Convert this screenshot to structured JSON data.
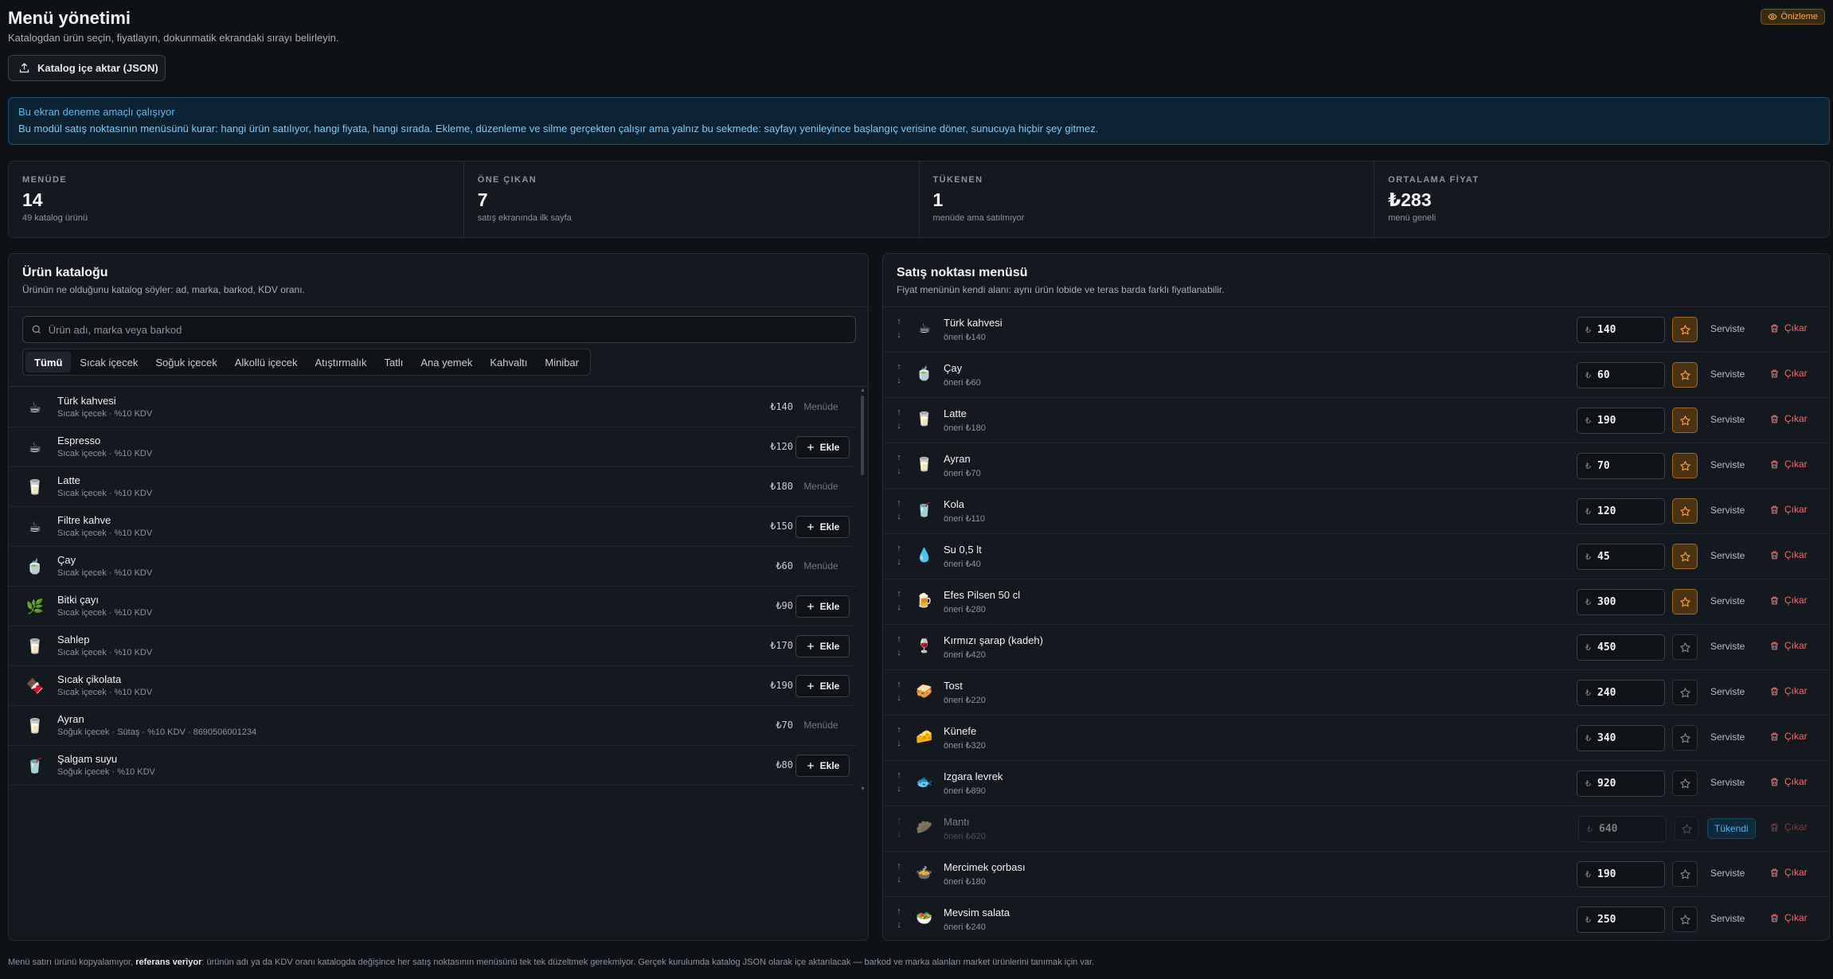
{
  "header": {
    "title": "Menü yönetimi",
    "subtitle": "Katalogdan ürün seçin, fiyatlayın, dokunmatik ekrandaki sırayı belirleyin.",
    "preview_label": "Önizleme"
  },
  "import_button": {
    "label": "Katalog içe aktar (JSON)"
  },
  "notice": {
    "title": "Bu ekran deneme amaçlı çalışıyor",
    "body": "Bu modül satış noktasının menüsünü kurar: hangi ürün satılıyor, hangi fiyata, hangi sırada. Ekleme, düzenleme ve silme gerçekten çalışır ama yalnız bu sekmede: sayfayı yenileyince başlangıç verisine döner, sunucuya hiçbir şey gitmez."
  },
  "stats": [
    {
      "label": "MENÜDE",
      "value": "14",
      "sub": "49 katalog ürünü"
    },
    {
      "label": "ÖNE ÇIKAN",
      "value": "7",
      "sub": "satış ekranında ilk sayfa"
    },
    {
      "label": "TÜKENEN",
      "value": "1",
      "sub": "menüde ama satılmıyor"
    },
    {
      "label": "ORTALAMA FİYAT",
      "value": "₺283",
      "sub": "menü geneli"
    }
  ],
  "catalog": {
    "title": "Ürün kataloğu",
    "subtitle": "Ürünün ne olduğunu katalog söyler: ad, marka, barkod, KDV oranı.",
    "search_placeholder": "Ürün adı, marka veya barkod",
    "tabs": [
      "Tümü",
      "Sıcak içecek",
      "Soğuk içecek",
      "Alkollü içecek",
      "Atıştırmalık",
      "Tatlı",
      "Ana yemek",
      "Kahvaltı",
      "Minibar"
    ],
    "in_menu_label": "Menüde",
    "add_label": "Ekle",
    "items": [
      {
        "emoji": "☕",
        "name": "Türk kahvesi",
        "meta": "Sıcak içecek · %10 KDV",
        "price": "₺140",
        "in_menu": true
      },
      {
        "emoji": "☕",
        "name": "Espresso",
        "meta": "Sıcak içecek · %10 KDV",
        "price": "₺120",
        "in_menu": false
      },
      {
        "emoji": "🥛",
        "name": "Latte",
        "meta": "Sıcak içecek · %10 KDV",
        "price": "₺180",
        "in_menu": true
      },
      {
        "emoji": "☕",
        "name": "Filtre kahve",
        "meta": "Sıcak içecek · %10 KDV",
        "price": "₺150",
        "in_menu": false
      },
      {
        "emoji": "🍵",
        "name": "Çay",
        "meta": "Sıcak içecek · %10 KDV",
        "price": "₺60",
        "in_menu": true
      },
      {
        "emoji": "🌿",
        "name": "Bitki çayı",
        "meta": "Sıcak içecek · %10 KDV",
        "price": "₺90",
        "in_menu": false
      },
      {
        "emoji": "🥛",
        "name": "Sahlep",
        "meta": "Sıcak içecek · %10 KDV",
        "price": "₺170",
        "in_menu": false
      },
      {
        "emoji": "🍫",
        "name": "Sıcak çikolata",
        "meta": "Sıcak içecek · %10 KDV",
        "price": "₺190",
        "in_menu": false
      },
      {
        "emoji": "🥛",
        "name": "Ayran",
        "meta": "Soğuk içecek · Sütaş · %10 KDV · 8690506001234",
        "price": "₺70",
        "in_menu": true
      },
      {
        "emoji": "🥤",
        "name": "Şalgam suyu",
        "meta": "Soğuk içecek · %10 KDV",
        "price": "₺80",
        "in_menu": false
      }
    ]
  },
  "menu": {
    "title": "Satış noktası menüsü",
    "subtitle": "Fiyat menünün kendi alanı: aynı ürün lobide ve teras barda farklı fiyatlanabilir.",
    "currency": "₺",
    "remove_label": "Çıkar",
    "items": [
      {
        "emoji": "☕",
        "name": "Türk kahvesi",
        "hint": "öneri ₺140",
        "price": "140",
        "featured": true,
        "status": "Serviste",
        "sold_out": false
      },
      {
        "emoji": "🍵",
        "name": "Çay",
        "hint": "öneri ₺60",
        "price": "60",
        "featured": true,
        "status": "Serviste",
        "sold_out": false
      },
      {
        "emoji": "🥛",
        "name": "Latte",
        "hint": "öneri ₺180",
        "price": "190",
        "featured": true,
        "status": "Serviste",
        "sold_out": false
      },
      {
        "emoji": "🥛",
        "name": "Ayran",
        "hint": "öneri ₺70",
        "price": "70",
        "featured": true,
        "status": "Serviste",
        "sold_out": false
      },
      {
        "emoji": "🥤",
        "name": "Kola",
        "hint": "öneri ₺110",
        "price": "120",
        "featured": true,
        "status": "Serviste",
        "sold_out": false
      },
      {
        "emoji": "💧",
        "name": "Su 0,5 lt",
        "hint": "öneri ₺40",
        "price": "45",
        "featured": true,
        "status": "Serviste",
        "sold_out": false
      },
      {
        "emoji": "🍺",
        "name": "Efes Pilsen 50 cl",
        "hint": "öneri ₺280",
        "price": "300",
        "featured": true,
        "status": "Serviste",
        "sold_out": false
      },
      {
        "emoji": "🍷",
        "name": "Kırmızı şarap (kadeh)",
        "hint": "öneri ₺420",
        "price": "450",
        "featured": false,
        "status": "Serviste",
        "sold_out": false
      },
      {
        "emoji": "🥪",
        "name": "Tost",
        "hint": "öneri ₺220",
        "price": "240",
        "featured": false,
        "status": "Serviste",
        "sold_out": false
      },
      {
        "emoji": "🧀",
        "name": "Künefe",
        "hint": "öneri ₺320",
        "price": "340",
        "featured": false,
        "status": "Serviste",
        "sold_out": false
      },
      {
        "emoji": "🐟",
        "name": "Izgara levrek",
        "hint": "öneri ₺890",
        "price": "920",
        "featured": false,
        "status": "Serviste",
        "sold_out": false
      },
      {
        "emoji": "🥟",
        "name": "Mantı",
        "hint": "öneri ₺620",
        "price": "640",
        "featured": false,
        "status": "Tükendi",
        "sold_out": true
      },
      {
        "emoji": "🍲",
        "name": "Mercimek çorbası",
        "hint": "öneri ₺180",
        "price": "190",
        "featured": false,
        "status": "Serviste",
        "sold_out": false
      },
      {
        "emoji": "🥗",
        "name": "Mevsim salata",
        "hint": "öneri ₺240",
        "price": "250",
        "featured": false,
        "status": "Serviste",
        "sold_out": false
      }
    ]
  },
  "footer": {
    "part1": "Menü satırı ürünü kopyalamıyor, ",
    "bold": "referans veriyor",
    "part2": ": ürünün adı ya da KDV oranı katalogda değişince her satış noktasının menüsünü tek tek düzeltmek gerekmiyor. Gerçek kurulumda katalog JSON olarak içe aktarılacak — barkod ve marka alanları market ürünlerini tanımak için var."
  },
  "colors": {
    "background": "#0e1217",
    "panel": "#141920",
    "accent_star": "#f0a030",
    "danger": "#f06a6a",
    "info": "#5cb6f0"
  }
}
